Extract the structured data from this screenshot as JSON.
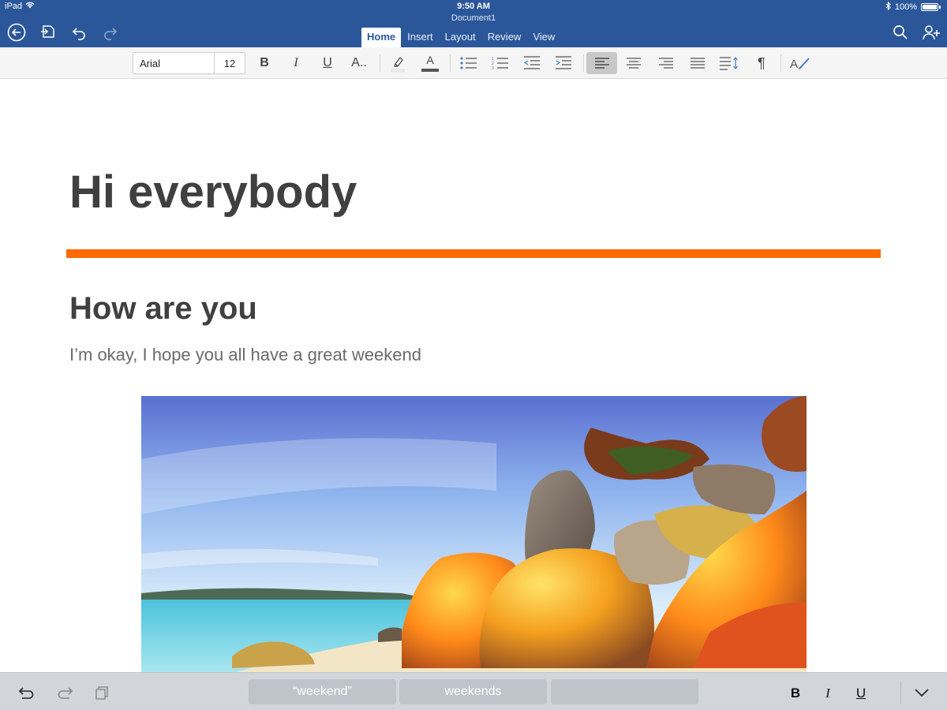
{
  "status_bar": {
    "device": "iPad",
    "time": "9:50 AM",
    "battery": "100%"
  },
  "document_title": "Document1",
  "tabs": [
    {
      "label": "Home",
      "active": true
    },
    {
      "label": "Insert",
      "active": false
    },
    {
      "label": "Layout",
      "active": false
    },
    {
      "label": "Review",
      "active": false
    },
    {
      "label": "View",
      "active": false
    }
  ],
  "ribbon": {
    "font_name": "Arial",
    "font_size": "12",
    "bold_label": "B",
    "italic_label": "I",
    "underline_label": "U",
    "font_options_label": "A..",
    "font_color_label": "A",
    "paragraph_mark": "¶"
  },
  "document": {
    "title": "Hi everybody",
    "heading": "How are you",
    "body": "I’m okay, I hope you all have a great weekend"
  },
  "suggestions": [
    "“weekend”",
    "weekends",
    ""
  ],
  "keyboard_bar": {
    "bold": "B",
    "italic": "I",
    "underline": "U"
  },
  "colors": {
    "brand": "#2b579a",
    "accent_rule": "#ff6a00"
  }
}
